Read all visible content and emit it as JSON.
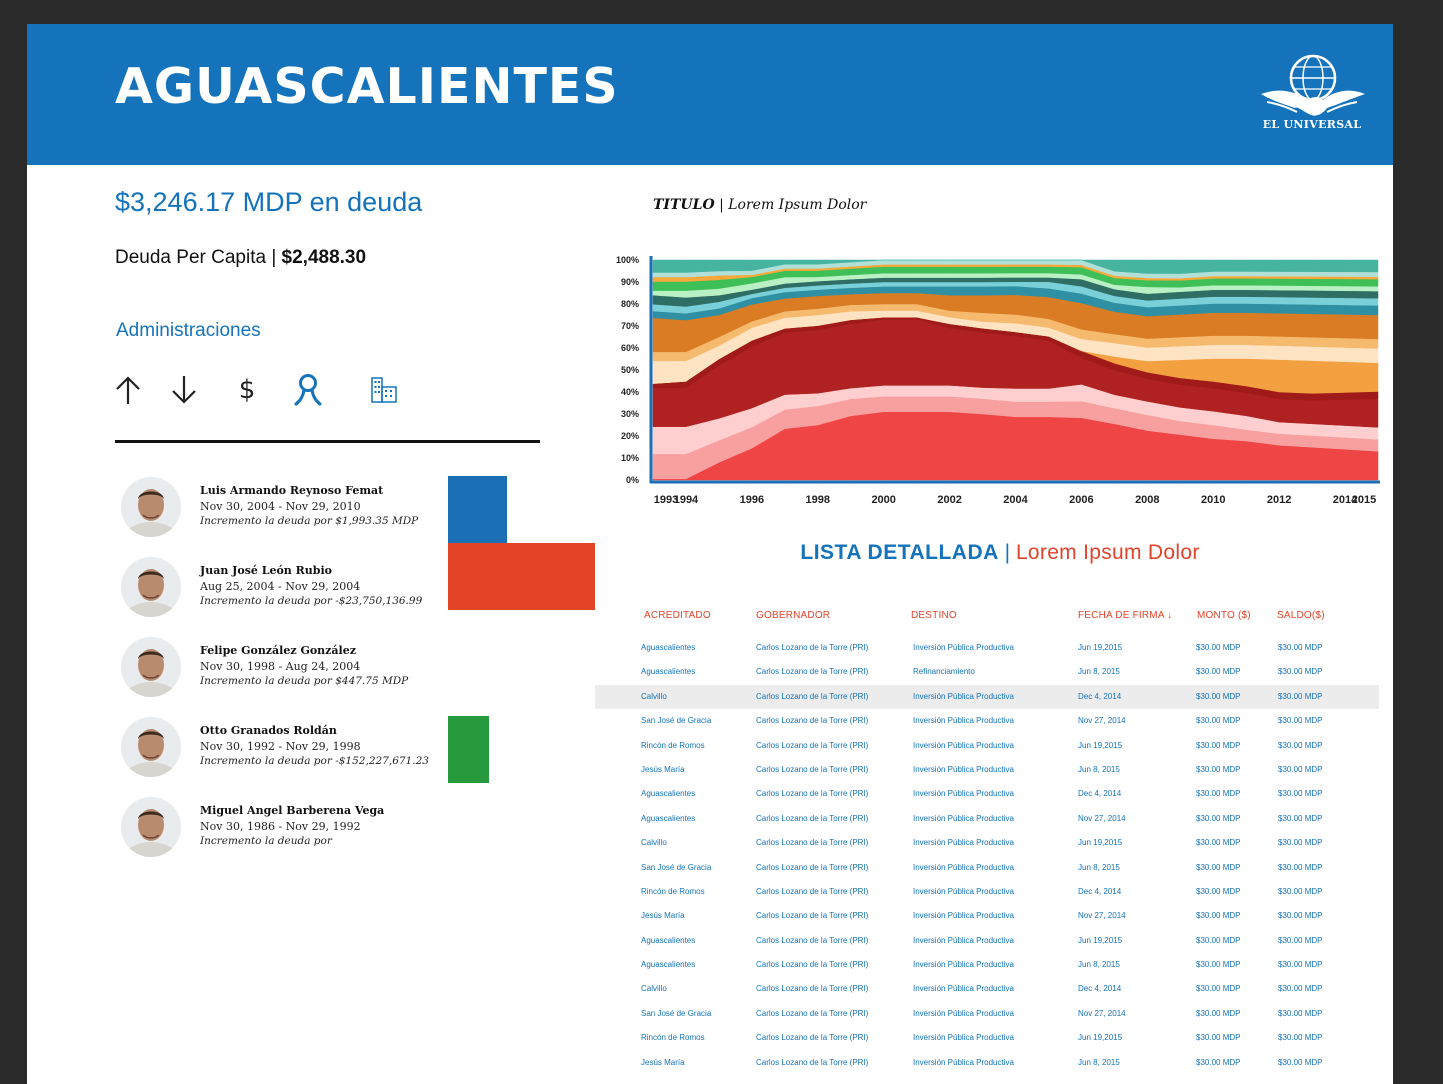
{
  "header": {
    "title": "AGUASCALIENTES",
    "brand": "EL UNIVERSAL"
  },
  "summary": {
    "debt_total": "$3,246.17 MDP en deuda",
    "per_capita_label": "Deuda Per Capita |",
    "per_capita_value": "$2,488.30"
  },
  "administrations": {
    "title": "Administraciones",
    "sort_icons": [
      "arrow-up-icon",
      "arrow-down-icon",
      "dollar-icon",
      "person-icon",
      "building-icon"
    ],
    "governors": [
      {
        "name": "Luis Armando Reynoso Femat",
        "dates": "Nov 30, 2004 - Nov 29, 2010",
        "change": "Incremento la deuda por $1,993.35 MDP",
        "bar_color": "#1a6fb5",
        "bar_level": 0.4
      },
      {
        "name": "Juan José León Rubio",
        "dates": "Aug 25, 2004 - Nov 29, 2004",
        "change": "Incremento la deuda por -$23,750,136.99",
        "bar_color": "#e34326",
        "bar_level": 1.0
      },
      {
        "name": "Felipe González González",
        "dates": "Nov 30, 1998 - Aug 24, 2004",
        "change": "Incremento la deuda por $447.75 MDP",
        "bar_color": "",
        "bar_level": 0
      },
      {
        "name": "Otto Granados Roldán",
        "dates": "Nov 30, 1992 - Nov 29, 1998",
        "change": "Incremento la deuda por -$152,227,671.23",
        "bar_color": "#279a3e",
        "bar_level": 0.28
      },
      {
        "name": "Miguel Angel Barberena Vega",
        "dates": "Nov 30, 1986 - Nov 29, 1992",
        "change": "Incremento la deuda por",
        "bar_color": "",
        "bar_level": 0
      }
    ]
  },
  "chart": {
    "title_bold": "TITULO",
    "title_rest": " | Lorem Ipsum Dolor",
    "axis_color": "#1a6fb5"
  },
  "chart_data": {
    "type": "area",
    "stacked": "percent",
    "x": [
      1993,
      1994,
      1995,
      1996,
      1997,
      1998,
      1999,
      2000,
      2001,
      2002,
      2003,
      2004,
      2005,
      2006,
      2007,
      2008,
      2009,
      2010,
      2011,
      2012,
      2013,
      2014,
      2015
    ],
    "x_tick_labels": [
      "1993",
      "1994",
      "1996",
      "1998",
      "2000",
      "2002",
      "2004",
      "2006",
      "2008",
      "2010",
      "2012",
      "2014",
      "2015"
    ],
    "y_tick_labels": [
      "0%",
      "10%",
      "20%",
      "30%",
      "40%",
      "50%",
      "60%",
      "70%",
      "80%",
      "90%",
      "100%"
    ],
    "ylim": [
      0,
      100
    ],
    "grid": false,
    "legend": "none",
    "series": [
      {
        "color": "#f04545",
        "values": [
          0.5,
          0.5,
          8,
          15,
          24,
          26,
          30,
          31,
          31,
          31,
          30,
          29,
          29,
          26,
          25,
          22,
          20,
          18,
          17,
          15,
          14,
          13,
          12
        ]
      },
      {
        "color": "#f8a0a0",
        "values": [
          11,
          11,
          10,
          10,
          9,
          9,
          8,
          7,
          7,
          7,
          7,
          7,
          7,
          7,
          7,
          7,
          6,
          6,
          5,
          5,
          5,
          5,
          5
        ]
      },
      {
        "color": "#ffcfcf",
        "values": [
          12,
          12,
          10,
          9,
          7,
          6,
          5,
          5,
          5,
          5,
          5,
          6,
          6,
          7,
          6,
          6,
          6,
          6,
          6,
          5,
          5,
          5,
          5
        ]
      },
      {
        "color": "#b02222",
        "values": [
          17,
          17,
          24,
          29,
          29,
          30,
          30,
          30,
          30,
          26,
          25,
          24,
          22,
          11,
          11,
          10,
          10,
          10,
          10,
          10,
          10,
          11,
          12
        ]
      },
      {
        "color": "#a01a1a",
        "values": [
          2,
          3,
          3,
          3,
          2,
          2,
          2,
          1,
          1,
          2,
          2,
          2,
          2,
          3,
          3,
          3,
          3,
          3,
          3,
          3,
          3,
          3,
          3
        ]
      },
      {
        "color": "#f3a040",
        "values": [
          0,
          0,
          0,
          0,
          0,
          0,
          0,
          0,
          0,
          0,
          0,
          0,
          0,
          0,
          3,
          5,
          8,
          10,
          12,
          14,
          14,
          13,
          12
        ]
      },
      {
        "color": "#ffe3c2",
        "values": [
          10,
          9,
          6,
          6,
          5,
          5,
          4,
          3,
          3,
          3,
          3,
          4,
          4,
          5,
          6,
          6,
          6,
          6,
          6,
          6,
          6,
          6,
          6
        ]
      },
      {
        "color": "#f6ba6e",
        "values": [
          4,
          4,
          4,
          3,
          3,
          3,
          3,
          3,
          3,
          3,
          4,
          4,
          4,
          4,
          4,
          4,
          4,
          4,
          4,
          4,
          4,
          4,
          4
        ]
      },
      {
        "color": "#d97c24",
        "values": [
          15,
          14,
          10,
          8,
          6,
          6,
          5,
          5,
          5,
          7,
          8,
          9,
          10,
          11,
          10,
          10,
          10,
          10,
          10,
          10,
          10,
          10,
          10
        ]
      },
      {
        "color": "#2f8fa3",
        "values": [
          3,
          3,
          3,
          3,
          3,
          3,
          3,
          3,
          3,
          4,
          4,
          4,
          4,
          4,
          4,
          4,
          4,
          4,
          4,
          4,
          4,
          4,
          4
        ]
      },
      {
        "color": "#79d0d8",
        "values": [
          3,
          3,
          3,
          2,
          2,
          2,
          2,
          2,
          2,
          2,
          2,
          2,
          3,
          3,
          3,
          3,
          3,
          3,
          3,
          3,
          3,
          3,
          3
        ]
      },
      {
        "color": "#2f6e64",
        "values": [
          4,
          4,
          3,
          2,
          2,
          2,
          2,
          2,
          2,
          2,
          2,
          2,
          2,
          3,
          3,
          3,
          3,
          3,
          3,
          3,
          3,
          3,
          3
        ]
      },
      {
        "color": "#b9f0c4",
        "values": [
          2,
          3,
          3,
          3,
          3,
          2,
          2,
          2,
          2,
          2,
          2,
          2,
          2,
          2,
          2,
          3,
          2,
          2,
          2,
          2,
          2,
          2,
          2
        ]
      },
      {
        "color": "#3fbf57",
        "values": [
          4,
          4,
          4,
          3,
          3,
          3,
          3,
          3,
          3,
          3,
          3,
          3,
          3,
          3,
          3,
          3,
          3,
          3,
          3,
          3,
          3,
          3,
          3
        ]
      },
      {
        "color": "#f6a93b",
        "values": [
          2,
          2,
          2,
          1,
          1,
          1,
          1,
          1,
          1,
          1,
          1,
          1,
          1,
          1,
          1,
          1,
          1,
          1,
          1,
          1,
          1,
          1,
          1
        ]
      },
      {
        "color": "#b0e0d8",
        "values": [
          2,
          2,
          2,
          2,
          2,
          2,
          2,
          2,
          2,
          2,
          2,
          2,
          2,
          2,
          2,
          2,
          2,
          2,
          2,
          2,
          2,
          2,
          2
        ]
      },
      {
        "color": "#47b4a0",
        "values": [
          5.5,
          5.5,
          5,
          5,
          2,
          2,
          1,
          0,
          0,
          0,
          0,
          0,
          0,
          0,
          5,
          6,
          6,
          5,
          5,
          5,
          5,
          5,
          5
        ]
      }
    ]
  },
  "list": {
    "heading_a": "LISTA DETALLADA",
    "heading_sep": "|",
    "heading_b": "Lorem Ipsum Dolor",
    "columns": [
      "ACREDITADO",
      "GOBERNADOR",
      "DESTINO",
      "FECHA DE FIRMA ↓",
      "MONTO ($)",
      "SALDO($)"
    ],
    "highlight_row": 2,
    "rows": [
      [
        "Aguascalientes",
        "Carlos Lozano de la Torre (PRI)",
        "Inversión Pública Productiva",
        "Jun 19,2015",
        "$30.00 MDP",
        "$30.00 MDP"
      ],
      [
        "Aguascalientes",
        "Carlos Lozano de la Torre (PRI)",
        "Refinanciamiento",
        "Jun 8, 2015",
        "$30.00 MDP",
        "$30.00 MDP"
      ],
      [
        "Calvillo",
        "Carlos Lozano de la Torre (PRI)",
        "Inversión Pública Productiva",
        "Dec 4, 2014",
        "$30.00 MDP",
        "$30.00 MDP"
      ],
      [
        "San José de Gracia",
        "Carlos Lozano de la Torre (PRI)",
        "Inversión Pública Productiva",
        "Nov 27, 2014",
        "$30.00 MDP",
        "$30.00 MDP"
      ],
      [
        "Rincón de Romos",
        "Carlos Lozano de la Torre (PRI)",
        "Inversión Pública Productiva",
        "Jun 19,2015",
        "$30.00 MDP",
        "$30.00 MDP"
      ],
      [
        "Jesús María",
        "Carlos Lozano de la Torre (PRI)",
        "Inversión Pública Productiva",
        "Jun 8, 2015",
        "$30.00 MDP",
        "$30.00 MDP"
      ],
      [
        "Aguascalientes",
        "Carlos Lozano de la Torre (PRI)",
        "Inversión Pública Productiva",
        "Dec 4, 2014",
        "$30.00 MDP",
        "$30.00 MDP"
      ],
      [
        "Aguascalientes",
        "Carlos Lozano de la Torre (PRI)",
        "Inversión Pública Productiva",
        "Nov 27, 2014",
        "$30.00 MDP",
        "$30.00 MDP"
      ],
      [
        "Calvillo",
        "Carlos Lozano de la Torre (PRI)",
        "Inversión Pública Productiva",
        "Jun 19,2015",
        "$30.00 MDP",
        "$30.00 MDP"
      ],
      [
        "San José de Gracia",
        "Carlos Lozano de la Torre (PRI)",
        "Inversión Pública Productiva",
        "Jun 8, 2015",
        "$30.00 MDP",
        "$30.00 MDP"
      ],
      [
        "Rincón de Romos",
        "Carlos Lozano de la Torre (PRI)",
        "Inversión Pública Productiva",
        "Dec 4, 2014",
        "$30.00 MDP",
        "$30.00 MDP"
      ],
      [
        "Jesús María",
        "Carlos Lozano de la Torre (PRI)",
        "Inversión Pública Productiva",
        "Nov 27, 2014",
        "$30.00 MDP",
        "$30.00 MDP"
      ],
      [
        "Aguascalientes",
        "Carlos Lozano de la Torre (PRI)",
        "Inversión Pública Productiva",
        "Jun 19,2015",
        "$30.00 MDP",
        "$30.00 MDP"
      ],
      [
        "Aguascalientes",
        "Carlos Lozano de la Torre (PRI)",
        "Inversión Pública Productiva",
        "Jun 8, 2015",
        "$30.00 MDP",
        "$30.00 MDP"
      ],
      [
        "Calvillo",
        "Carlos Lozano de la Torre (PRI)",
        "Inversión Pública Productiva",
        "Dec 4, 2014",
        "$30.00 MDP",
        "$30.00 MDP"
      ],
      [
        "San José de Gracia",
        "Carlos Lozano de la Torre (PRI)",
        "Inversión Pública Productiva",
        "Nov 27, 2014",
        "$30.00 MDP",
        "$30.00 MDP"
      ],
      [
        "Rincón de Romos",
        "Carlos Lozano de la Torre (PRI)",
        "Inversión Pública Productiva",
        "Jun 19,2015",
        "$30.00 MDP",
        "$30.00 MDP"
      ],
      [
        "Jesús María",
        "Carlos Lozano de la Torre (PRI)",
        "Inversión Pública Productiva",
        "Jun 8, 2015",
        "$30.00 MDP",
        "$30.00 MDP"
      ]
    ]
  }
}
